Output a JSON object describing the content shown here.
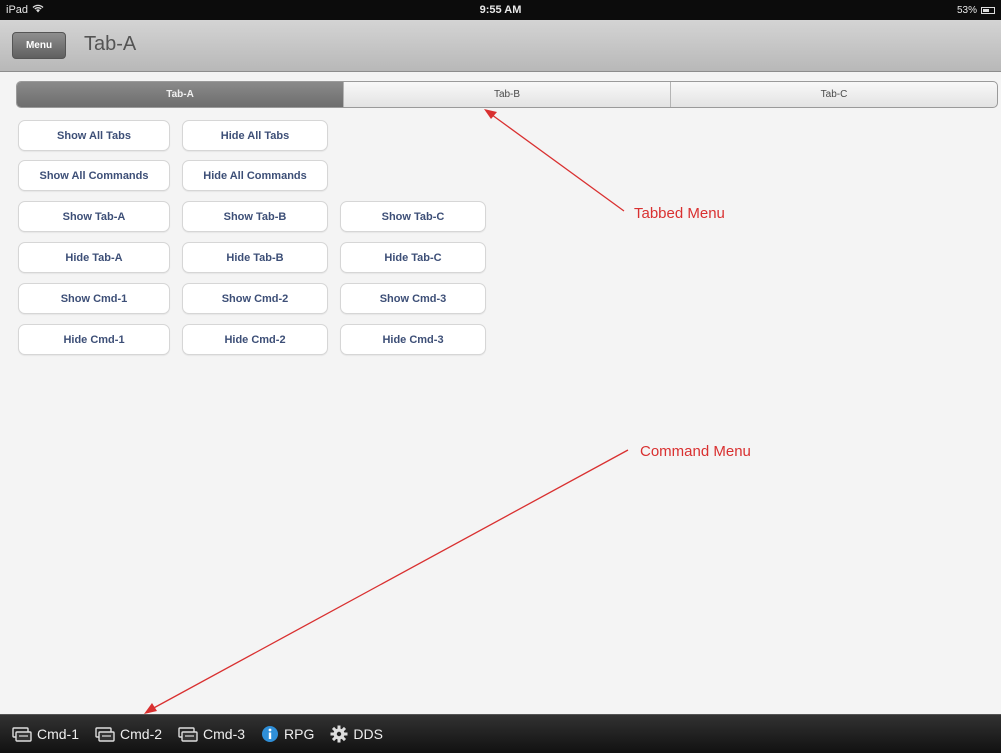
{
  "status_bar": {
    "device": "iPad",
    "time": "9:55 AM",
    "battery": "53%"
  },
  "nav": {
    "menu_label": "Menu",
    "title": "Tab-A"
  },
  "tabs": [
    {
      "label": "Tab-A",
      "active": true
    },
    {
      "label": "Tab-B",
      "active": false
    },
    {
      "label": "Tab-C",
      "active": false
    }
  ],
  "buttons": {
    "show_all_tabs": "Show All Tabs",
    "hide_all_tabs": "Hide All Tabs",
    "show_all_commands": "Show All Commands",
    "hide_all_commands": "Hide All Commands",
    "show_tab_a": "Show Tab-A",
    "show_tab_b": "Show Tab-B",
    "show_tab_c": "Show Tab-C",
    "hide_tab_a": "Hide Tab-A",
    "hide_tab_b": "Hide Tab-B",
    "hide_tab_c": "Hide Tab-C",
    "show_cmd_1": "Show Cmd-1",
    "show_cmd_2": "Show Cmd-2",
    "show_cmd_3": "Show Cmd-3",
    "hide_cmd_1": "Hide Cmd-1",
    "hide_cmd_2": "Hide Cmd-2",
    "hide_cmd_3": "Hide Cmd-3"
  },
  "annotations": {
    "tabbed_menu": "Tabbed Menu",
    "command_menu": "Command Menu",
    "color": "#d93030"
  },
  "commands": [
    {
      "label": "Cmd-1",
      "icon": "terminal-icon"
    },
    {
      "label": "Cmd-2",
      "icon": "terminal-icon"
    },
    {
      "label": "Cmd-3",
      "icon": "terminal-icon"
    },
    {
      "label": "RPG",
      "icon": "info-icon"
    },
    {
      "label": "DDS",
      "icon": "gear-icon"
    }
  ]
}
